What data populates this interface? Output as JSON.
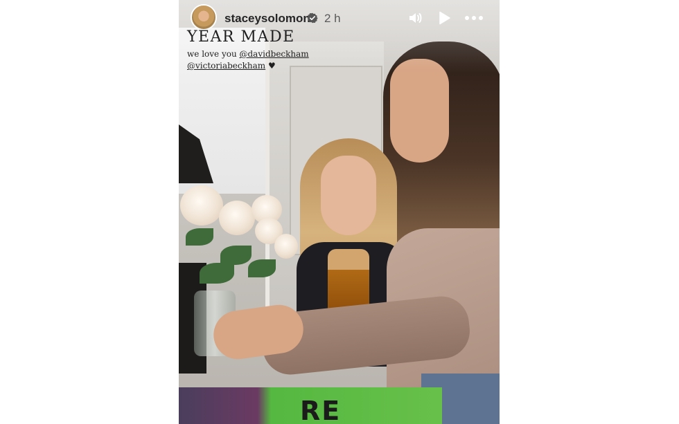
{
  "story": {
    "username": "staceysolomon",
    "time_ago": "2 h",
    "icons": {
      "verified": "verified-badge-icon",
      "sound": "speaker-icon",
      "play": "play-icon",
      "more": "more-options-icon"
    },
    "caption": {
      "title": "YEAR MADE",
      "line1_text": "we love you ",
      "mention1": "@davidbeckham",
      "mention2": "@victoriabeckham",
      "heart": "♥"
    },
    "background_text": "RE"
  },
  "colors": {
    "page_bg": "#ffffff",
    "text_dark": "#262626",
    "verified_blue": "#555555"
  }
}
